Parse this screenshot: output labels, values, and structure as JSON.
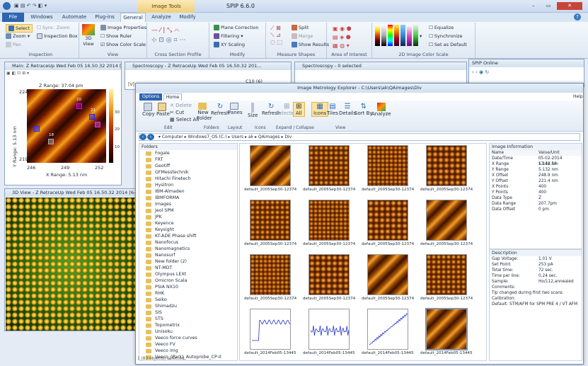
{
  "app": {
    "title": "SPIP 6.6.0",
    "context_tab": "Image Tools"
  },
  "tabs": [
    "File",
    "Windows",
    "Automate",
    "Plug-ins",
    "General",
    "Analyze",
    "Modify"
  ],
  "ribbon": {
    "inspection": {
      "label": "Inspection",
      "select": "Select",
      "zoom": "Zoom",
      "pan": "Pan",
      "sync_zoom": "Sync. Zoom",
      "inspection_box": "Inspection Box"
    },
    "view": {
      "label": "View",
      "view3d": "3D View",
      "image_properties": "Image Properties",
      "show_ruler": "Show Ruler",
      "show_color_scale": "Show Color Scale"
    },
    "cross_section": {
      "label": "Cross Section Profile"
    },
    "modify": {
      "label": "Modify",
      "plane_correction": "Plane Correction",
      "filtering": "Filtering",
      "xy_scaling": "XY Scaling"
    },
    "measure": {
      "label": "Measure Shapes",
      "split": "Split",
      "merge": "Merge",
      "show_results": "Show Results"
    },
    "aoi": {
      "label": "Area of Interest"
    },
    "colorscale": {
      "label": "2D Image Color Scale",
      "equalize": "Equalize",
      "synchronize": "Synchronize",
      "set_default": "Set as Default"
    }
  },
  "main_window": {
    "title": "Main: Z RetraceUp Wed Feb 05 16.50.32 2014 [6-2] STI",
    "zrange": "Z Range: 37.04 pm",
    "xrange": "X Range: 5.13 nm",
    "yrange": "Y Range: 5.13 nm",
    "xticks": [
      "246",
      "249",
      "252"
    ],
    "yticks": [
      "224",
      "219"
    ],
    "cbar": [
      "10",
      "20",
      "30"
    ],
    "markers": [
      "18",
      "20",
      "21",
      "19",
      "20",
      "20"
    ]
  },
  "spectro1": {
    "title": "Spectroscopy - Z RetraceUp Wed Feb 05 16.50.32 201...",
    "combo": "C10 (6)"
  },
  "spectro2": {
    "title": "Spectroscopy - 0 selected"
  },
  "spip_online": {
    "title": "SPIP Online"
  },
  "view3d": {
    "title": "3D View - Z RetraceUp Wed Feb 05 16.50.32 2014 [6-2] STM"
  },
  "explorer": {
    "title": "Image Metrology Explorer - C:\\Users\\ak\\QAimages\\Div",
    "tabs": [
      "Options",
      "Home"
    ],
    "help": "Help",
    "buttons": [
      "Copy",
      "Paste",
      "Delete",
      "Cut",
      "Select All",
      "New Folder",
      "Refresh",
      "Panes",
      "Size",
      "Refresh",
      "Selected",
      "All",
      "Icons",
      "Tiles",
      "Details",
      "Sort By",
      "Analyze"
    ],
    "groups": [
      "Edit",
      "Folders",
      "Layout",
      "Icons",
      "Expand / Collapse",
      "View",
      ""
    ],
    "breadcrumb": [
      "Computer",
      "Windows7_OS (C:)",
      "Users",
      "ak",
      "QAimages",
      "Div"
    ],
    "folders_label": "Folders",
    "folders": [
      "Fogale",
      "FRT",
      "Geotiff",
      "GFMesstechnik",
      "Hitachi Finetech",
      "Hysitron",
      "IBM-Almaden",
      "IBMFORMA",
      "Images",
      "Jeol SPM",
      "JPK",
      "Keyence",
      "Keysight",
      "KT-ADE Phase shift",
      "Nanofocus",
      "Nanomagnetics",
      "Nanosurf",
      "New folder (2)",
      "NT-MDT",
      "Olympus LEXt",
      "Omicron Scala",
      "PSIA NX10",
      "RHK",
      "Seiko",
      "Shimadzu",
      "SIS",
      "STS",
      "Topometrix",
      "Unisoku",
      "Veeco force curves",
      "Veeco FV",
      "Veeco img",
      "Veeco_(Park)_Autoprobe_CP-II",
      "Aarhus Mul"
    ],
    "thumb_labels": [
      "default_2005Sep30-123743_ST...",
      "default_2005Sep30-123743_ST...",
      "default_2005Sep30-123743_ST...",
      "default_2005Sep30-123743_ST...",
      "default_2005Sep30-123743_ST...",
      "default_2005Sep30-123743_ST...",
      "default_2005Sep30-123743_ST...",
      "default_2005Sep30-123743_ST...",
      "default_2005Sep30-123743_ST...",
      "default_2005Sep30-123743_ST...",
      "default_2005Sep30-123743_ST...",
      "default_2005Sep30-123743_ST...",
      "default_2014Feb05-134456_ST...",
      "default_2014Feb05-134456_ST...",
      "default_2014Feb05-134456_ST...",
      "default_2014Feb05-134456_ST..."
    ],
    "status": "1 (83 objects) selected",
    "info_title": "Image Information",
    "info_header": [
      "Name",
      "Value/Unit"
    ],
    "info": [
      [
        "Date/Time",
        "05-02-2014 13:44:56"
      ],
      [
        "X Range",
        "5.132 nm"
      ],
      [
        "Y Range",
        "5.132 nm"
      ],
      [
        "X Offset",
        "248.9 nm"
      ],
      [
        "Y Offset",
        "221.4 nm"
      ],
      [
        "X Points",
        "400"
      ],
      [
        "Y Points",
        "400"
      ],
      [
        "Data Type",
        "Z"
      ],
      [
        "Data Range",
        "207.7pm"
      ],
      [
        "Data Offset",
        "0 pm"
      ]
    ],
    "desc_title": "Description",
    "desc": [
      [
        "Gap Voltage:",
        "1.01 V"
      ],
      [
        "Set Point:",
        "253 pA"
      ],
      [
        "Total time:",
        "72 sec."
      ],
      [
        "Time per line:",
        "0.24 sec."
      ],
      [
        "Sample:",
        "Ho/112,annealed"
      ]
    ],
    "comments": [
      "Comments:",
      "Tip changed during first two scans",
      "Calibration:",
      "Default: STM/AFM for SPM PRE 4 / VT AFM"
    ]
  }
}
